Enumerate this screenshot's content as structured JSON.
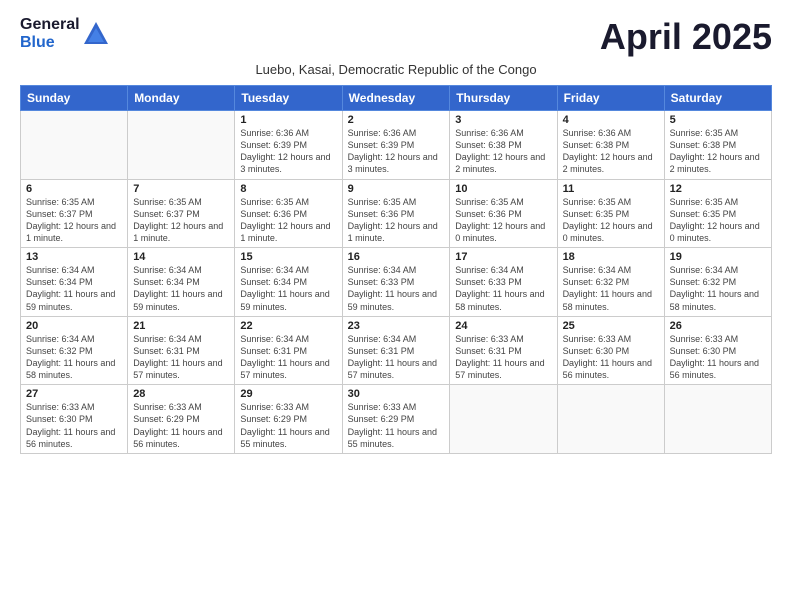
{
  "logo": {
    "general": "General",
    "blue": "Blue"
  },
  "title": "April 2025",
  "subtitle": "Luebo, Kasai, Democratic Republic of the Congo",
  "days_of_week": [
    "Sunday",
    "Monday",
    "Tuesday",
    "Wednesday",
    "Thursday",
    "Friday",
    "Saturday"
  ],
  "weeks": [
    [
      {
        "num": "",
        "info": ""
      },
      {
        "num": "",
        "info": ""
      },
      {
        "num": "1",
        "info": "Sunrise: 6:36 AM\nSunset: 6:39 PM\nDaylight: 12 hours and 3 minutes."
      },
      {
        "num": "2",
        "info": "Sunrise: 6:36 AM\nSunset: 6:39 PM\nDaylight: 12 hours and 3 minutes."
      },
      {
        "num": "3",
        "info": "Sunrise: 6:36 AM\nSunset: 6:38 PM\nDaylight: 12 hours and 2 minutes."
      },
      {
        "num": "4",
        "info": "Sunrise: 6:36 AM\nSunset: 6:38 PM\nDaylight: 12 hours and 2 minutes."
      },
      {
        "num": "5",
        "info": "Sunrise: 6:35 AM\nSunset: 6:38 PM\nDaylight: 12 hours and 2 minutes."
      }
    ],
    [
      {
        "num": "6",
        "info": "Sunrise: 6:35 AM\nSunset: 6:37 PM\nDaylight: 12 hours and 1 minute."
      },
      {
        "num": "7",
        "info": "Sunrise: 6:35 AM\nSunset: 6:37 PM\nDaylight: 12 hours and 1 minute."
      },
      {
        "num": "8",
        "info": "Sunrise: 6:35 AM\nSunset: 6:36 PM\nDaylight: 12 hours and 1 minute."
      },
      {
        "num": "9",
        "info": "Sunrise: 6:35 AM\nSunset: 6:36 PM\nDaylight: 12 hours and 1 minute."
      },
      {
        "num": "10",
        "info": "Sunrise: 6:35 AM\nSunset: 6:36 PM\nDaylight: 12 hours and 0 minutes."
      },
      {
        "num": "11",
        "info": "Sunrise: 6:35 AM\nSunset: 6:35 PM\nDaylight: 12 hours and 0 minutes."
      },
      {
        "num": "12",
        "info": "Sunrise: 6:35 AM\nSunset: 6:35 PM\nDaylight: 12 hours and 0 minutes."
      }
    ],
    [
      {
        "num": "13",
        "info": "Sunrise: 6:34 AM\nSunset: 6:34 PM\nDaylight: 11 hours and 59 minutes."
      },
      {
        "num": "14",
        "info": "Sunrise: 6:34 AM\nSunset: 6:34 PM\nDaylight: 11 hours and 59 minutes."
      },
      {
        "num": "15",
        "info": "Sunrise: 6:34 AM\nSunset: 6:34 PM\nDaylight: 11 hours and 59 minutes."
      },
      {
        "num": "16",
        "info": "Sunrise: 6:34 AM\nSunset: 6:33 PM\nDaylight: 11 hours and 59 minutes."
      },
      {
        "num": "17",
        "info": "Sunrise: 6:34 AM\nSunset: 6:33 PM\nDaylight: 11 hours and 58 minutes."
      },
      {
        "num": "18",
        "info": "Sunrise: 6:34 AM\nSunset: 6:32 PM\nDaylight: 11 hours and 58 minutes."
      },
      {
        "num": "19",
        "info": "Sunrise: 6:34 AM\nSunset: 6:32 PM\nDaylight: 11 hours and 58 minutes."
      }
    ],
    [
      {
        "num": "20",
        "info": "Sunrise: 6:34 AM\nSunset: 6:32 PM\nDaylight: 11 hours and 58 minutes."
      },
      {
        "num": "21",
        "info": "Sunrise: 6:34 AM\nSunset: 6:31 PM\nDaylight: 11 hours and 57 minutes."
      },
      {
        "num": "22",
        "info": "Sunrise: 6:34 AM\nSunset: 6:31 PM\nDaylight: 11 hours and 57 minutes."
      },
      {
        "num": "23",
        "info": "Sunrise: 6:34 AM\nSunset: 6:31 PM\nDaylight: 11 hours and 57 minutes."
      },
      {
        "num": "24",
        "info": "Sunrise: 6:33 AM\nSunset: 6:31 PM\nDaylight: 11 hours and 57 minutes."
      },
      {
        "num": "25",
        "info": "Sunrise: 6:33 AM\nSunset: 6:30 PM\nDaylight: 11 hours and 56 minutes."
      },
      {
        "num": "26",
        "info": "Sunrise: 6:33 AM\nSunset: 6:30 PM\nDaylight: 11 hours and 56 minutes."
      }
    ],
    [
      {
        "num": "27",
        "info": "Sunrise: 6:33 AM\nSunset: 6:30 PM\nDaylight: 11 hours and 56 minutes."
      },
      {
        "num": "28",
        "info": "Sunrise: 6:33 AM\nSunset: 6:29 PM\nDaylight: 11 hours and 56 minutes."
      },
      {
        "num": "29",
        "info": "Sunrise: 6:33 AM\nSunset: 6:29 PM\nDaylight: 11 hours and 55 minutes."
      },
      {
        "num": "30",
        "info": "Sunrise: 6:33 AM\nSunset: 6:29 PM\nDaylight: 11 hours and 55 minutes."
      },
      {
        "num": "",
        "info": ""
      },
      {
        "num": "",
        "info": ""
      },
      {
        "num": "",
        "info": ""
      }
    ]
  ]
}
